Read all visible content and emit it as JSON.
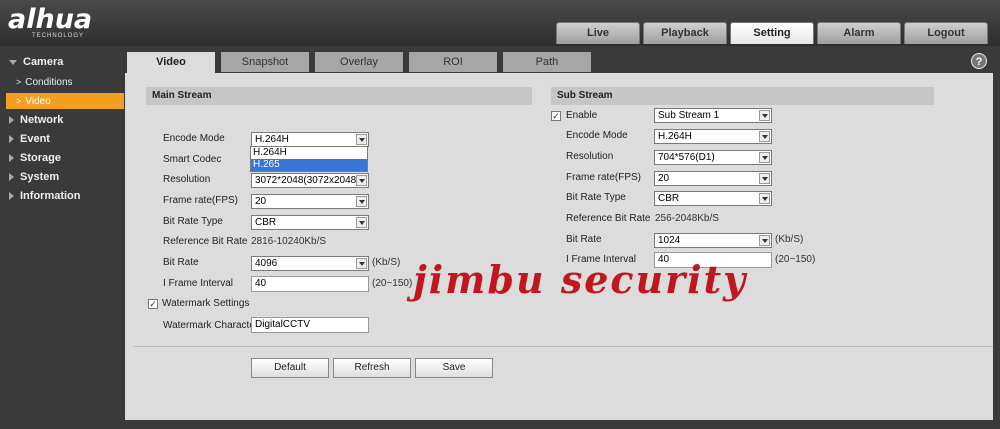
{
  "brand": {
    "logo": "alhua",
    "sub": "TECHNOLOGY"
  },
  "topnav": [
    "Live",
    "Playback",
    "Setting",
    "Alarm",
    "Logout"
  ],
  "topnav_active": "Setting",
  "sidebar": {
    "camera": "Camera",
    "camera_children": [
      {
        "label": "Conditions",
        "active": false
      },
      {
        "label": "Video",
        "active": true
      }
    ],
    "items": [
      "Network",
      "Event",
      "Storage",
      "System",
      "Information"
    ]
  },
  "tabs": [
    "Video",
    "Snapshot",
    "Overlay",
    "ROI",
    "Path"
  ],
  "active_tab": "Video",
  "main_stream": {
    "title": "Main Stream",
    "encode_mode_label": "Encode Mode",
    "encode_mode": "H.264H",
    "encode_options": [
      "H.264H",
      "H.265"
    ],
    "smart_codec_label": "Smart Codec",
    "resolution_label": "Resolution",
    "resolution": "3072*2048(3072x2048)",
    "frame_rate_label": "Frame rate(FPS)",
    "frame_rate": "20",
    "bit_rate_type_label": "Bit Rate Type",
    "bit_rate_type": "CBR",
    "ref_bit_rate_label": "Reference Bit Rate",
    "ref_bit_rate": "2816-10240Kb/S",
    "bit_rate_label": "Bit Rate",
    "bit_rate": "4096",
    "bit_rate_unit": "(Kb/S)",
    "iframe_label": "I Frame Interval",
    "iframe": "40",
    "iframe_range": "(20~150)",
    "watermark_settings_label": "Watermark Settings",
    "watermark_char_label": "Watermark Character",
    "watermark_char": "DigitalCCTV"
  },
  "sub_stream": {
    "title": "Sub Stream",
    "enable_label": "Enable",
    "stream": "Sub Stream 1",
    "encode_mode_label": "Encode Mode",
    "encode_mode": "H.264H",
    "resolution_label": "Resolution",
    "resolution": "704*576(D1)",
    "frame_rate_label": "Frame rate(FPS)",
    "frame_rate": "20",
    "bit_rate_type_label": "Bit Rate Type",
    "bit_rate_type": "CBR",
    "ref_bit_rate_label": "Reference Bit Rate",
    "ref_bit_rate": "256-2048Kb/S",
    "bit_rate_label": "Bit Rate",
    "bit_rate": "1024",
    "bit_rate_unit": "(Kb/S)",
    "iframe_label": "I Frame Interval",
    "iframe": "40",
    "iframe_range": "(20~150)"
  },
  "buttons": {
    "default": "Default",
    "refresh": "Refresh",
    "save": "Save"
  },
  "overlay_text": "jimbu security",
  "colors": {
    "accent": "#f29e20",
    "watermark": "#c0171f",
    "highlight": "#3875d7"
  }
}
